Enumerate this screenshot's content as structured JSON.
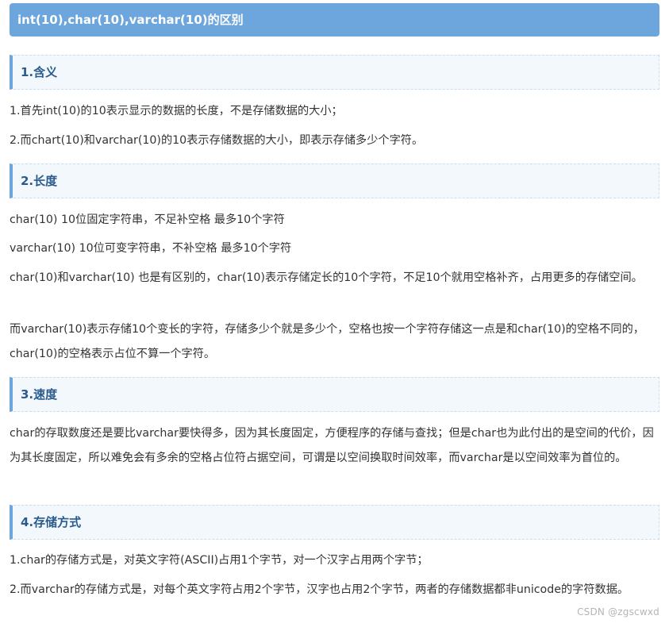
{
  "title": "int(10),char(10),varchar(10)的区别",
  "sections": [
    {
      "heading": "1.含义",
      "paragraphs": [
        "1.首先int(10)的10表示显示的数据的长度，不是存储数据的大小；",
        "2.而chart(10)和varchar(10)的10表示存储数据的大小，即表示存储多少个字符。"
      ]
    },
    {
      "heading": "2.长度",
      "paragraphs": [
        "char(10) 10位固定字符串，不足补空格 最多10个字符",
        "varchar(10) 10位可变字符串，不补空格 最多10个字符",
        "char(10)和varchar(10) 也是有区别的，char(10)表示存储定长的10个字符，不足10个就用空格补齐，占用更多的存储空间。",
        "而varchar(10)表示存储10个变长的字符，存储多少个就是多少个，空格也按一个字符存储这一点是和char(10)的空格不同的，char(10)的空格表示占位不算一个字符。"
      ]
    },
    {
      "heading": "3.速度",
      "paragraphs": [
        "char的存取数度还是要比varchar要快得多，因为其长度固定，方便程序的存储与查找；但是char也为此付出的是空间的代价，因为其长度固定，所以难免会有多余的空格占位符占据空间，可谓是以空间换取时间效率，而varchar是以空间效率为首位的。"
      ]
    },
    {
      "heading": "4.存储方式",
      "paragraphs": [
        "1.char的存储方式是，对英文字符(ASCII)占用1个字节，对一个汉字占用两个字节；",
        "2.而varchar的存储方式是，对每个英文字符占用2个字节，汉字也占用2个字节，两者的存储数据都非unicode的字符数据。"
      ]
    }
  ],
  "watermark": "CSDN @zgscwxd",
  "colors": {
    "title_bg": "#6ca6dd",
    "heading_bg": "#f3f8fd",
    "heading_text": "#2a5b8c",
    "body_text": "#333333"
  }
}
